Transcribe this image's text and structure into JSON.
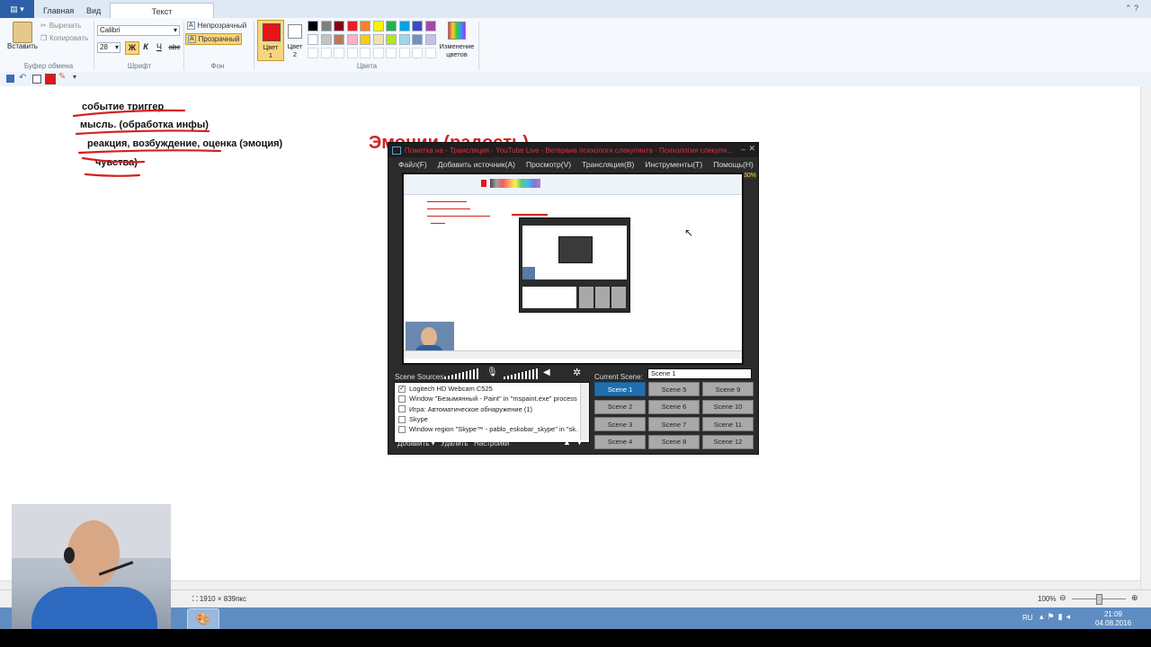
{
  "ribbon": {
    "file_tab": "▤ ▾",
    "tabs": [
      "Главная",
      "Вид",
      "Текст"
    ],
    "active_tab": "Текст",
    "clipboard": {
      "paste": "Вставить",
      "cut": "Вырезать",
      "copy": "Копировать",
      "label": "Буфер обмена"
    },
    "font": {
      "name": "Calibri",
      "size": "28",
      "bold": "Ж",
      "italic": "К",
      "underline": "Ч",
      "strike": "abc",
      "label": "Шрифт"
    },
    "background": {
      "opaque": "Непрозрачный",
      "transparent": "Прозрачный",
      "label": "Фон"
    },
    "color1": {
      "label": "Цвет",
      "num": "1",
      "value": "#e8141a"
    },
    "color2": {
      "label": "Цвет",
      "num": "2",
      "value": "#ffffff"
    },
    "colors_label": "Цвета",
    "edit_colors": "Изменение цветов",
    "palette_row1": [
      "#000000",
      "#7f7f7f",
      "#880015",
      "#ed1c24",
      "#ff7f27",
      "#fff200",
      "#22b14c",
      "#00a2e8",
      "#3f48cc",
      "#a349a4"
    ],
    "palette_row2": [
      "#ffffff",
      "#c3c3c3",
      "#b97a57",
      "#ffaec9",
      "#ffc90e",
      "#efe4b0",
      "#b5e61d",
      "#99d9ea",
      "#7092be",
      "#c8bfe7"
    ]
  },
  "canvas": {
    "lines": [
      "событие триггер",
      "мысль. (обработка инфы)",
      "реакция, возбуждение, оценка (эмоция)",
      "чувства)"
    ],
    "red_title": "Эмоции (радость)"
  },
  "obs": {
    "title": "Пометка на - Трансляция - YouTube Live - Ветерана психологи слекулянта - Психология слекуля...",
    "menu": [
      "Файл(F)",
      "Добавить источник(A)",
      "Просмотр(V)",
      "Трансляция(B)",
      "Инструменты(T)",
      "Помощь(H)"
    ],
    "percent": "30%",
    "scene_sources_label": "Scene Sources:",
    "current_scene_label": "Current Scene:",
    "current_scene_value": "Scene 1",
    "sources": [
      {
        "name": "Logitech HD Webcam C525",
        "checked": true
      },
      {
        "name": "Window \"Безымянный - Paint\" in \"mspaint.exe\" process",
        "checked": false
      },
      {
        "name": "Игра: Автоматическое обнаружение (1)",
        "checked": false
      },
      {
        "name": "Skype",
        "checked": false
      },
      {
        "name": "Window region \"Skype™ - pablo_eskobar_skype\" in \"sk...",
        "checked": false
      }
    ],
    "source_buttons": {
      "add": "Добавить",
      "remove": "Удалить",
      "settings": "Настройки"
    },
    "scenes": [
      "Scene 1",
      "Scene 5",
      "Scene 9",
      "Scene 2",
      "Scene 6",
      "Scene 10",
      "Scene 3",
      "Scene 7",
      "Scene 11",
      "Scene 4",
      "Scene 8",
      "Scene 12"
    ],
    "selected_scene": "Scene 1"
  },
  "statusbar": {
    "dimensions": "1910 × 839пкс",
    "zoom": "100%"
  },
  "taskbar": {
    "lang": "RU",
    "time": "21:09",
    "date": "04.08.2016"
  }
}
